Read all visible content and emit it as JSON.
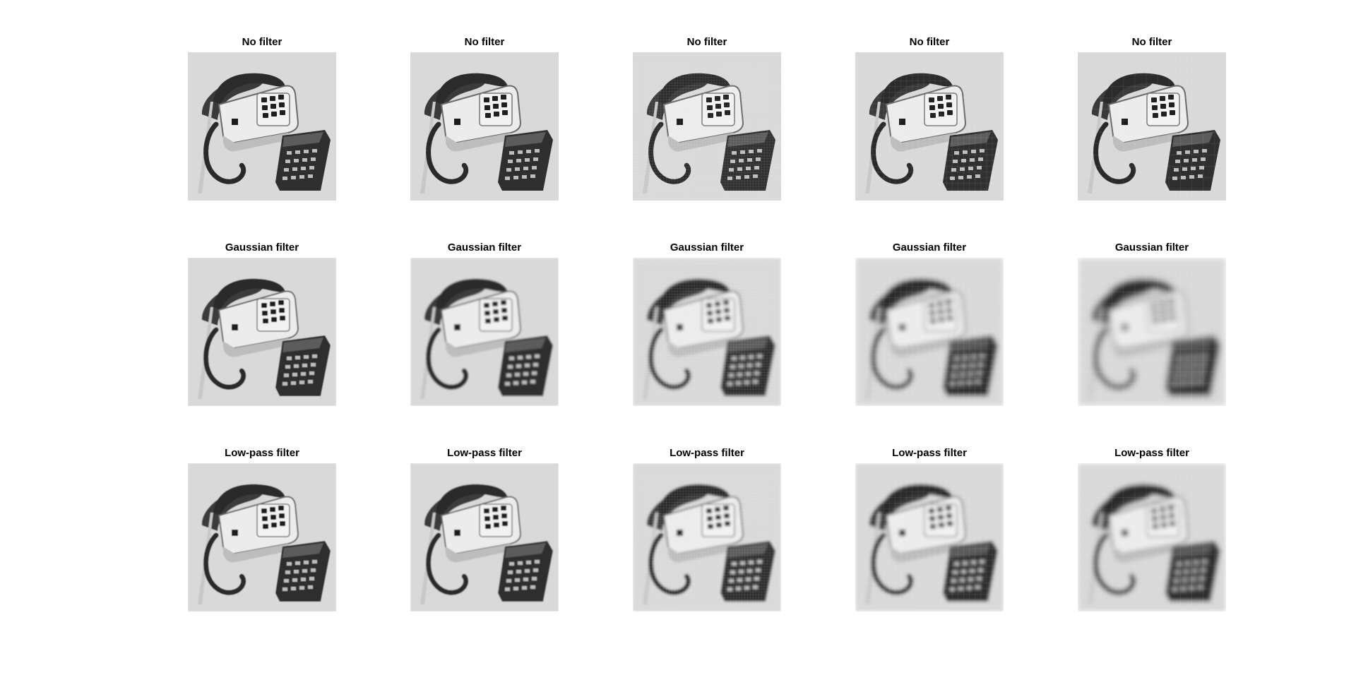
{
  "figure": {
    "background": "#ffffff",
    "rows": [
      {
        "filter": "none",
        "panels": [
          {
            "title": "No filter"
          },
          {
            "title": "No filter"
          },
          {
            "title": "No filter"
          },
          {
            "title": "No filter"
          },
          {
            "title": "No filter"
          }
        ]
      },
      {
        "filter": "gaussian",
        "panels": [
          {
            "title": "Gaussian filter"
          },
          {
            "title": "Gaussian filter"
          },
          {
            "title": "Gaussian filter"
          },
          {
            "title": "Gaussian filter"
          },
          {
            "title": "Gaussian filter"
          }
        ]
      },
      {
        "filter": "lowpass",
        "panels": [
          {
            "title": "Low-pass filter"
          },
          {
            "title": "Low-pass filter"
          },
          {
            "title": "Low-pass filter"
          },
          {
            "title": "Low-pass filter"
          },
          {
            "title": "Low-pass filter"
          }
        ]
      }
    ],
    "image_subject": "grayscale photo of a desk telephone with coiled cord and a calculator",
    "colormap": "gray"
  }
}
